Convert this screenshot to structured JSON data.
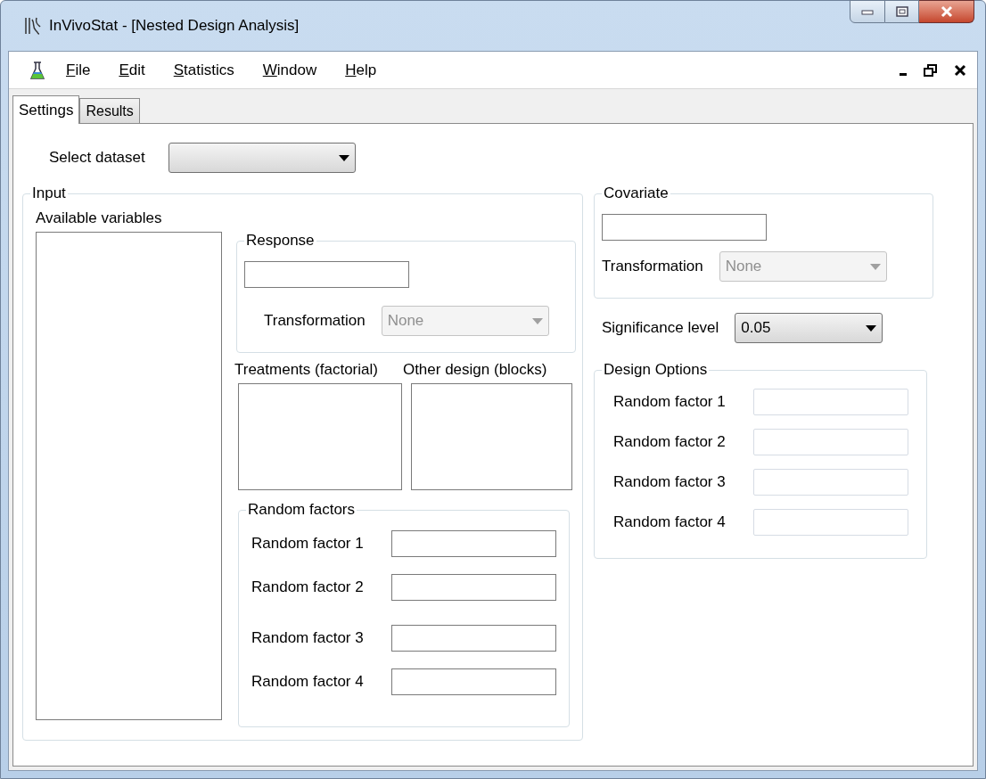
{
  "window": {
    "title": "InVivoStat - [Nested Design Analysis]"
  },
  "menu": [
    "File",
    "Edit",
    "Statistics",
    "Window",
    "Help"
  ],
  "tabs": [
    {
      "label": "Settings",
      "selected": true
    },
    {
      "label": "Results",
      "selected": false
    }
  ],
  "dataset": {
    "label": "Select dataset"
  },
  "input": {
    "title": "Input",
    "available_label": "Available variables",
    "response": {
      "title": "Response",
      "transformation_label": "Transformation",
      "transformation_value": "None",
      "disabled": true
    },
    "treatments_label": "Treatments (factorial)",
    "other_design_label": "Other design (blocks)",
    "random_factors": {
      "title": "Random factors",
      "items": [
        {
          "label": "Random factor 1",
          "disabled": false
        },
        {
          "label": "Random factor 2",
          "disabled": false
        },
        {
          "label": "Random factor 3",
          "disabled": false
        },
        {
          "label": "Random factor 4",
          "disabled": false
        }
      ]
    }
  },
  "covariate": {
    "title": "Covariate",
    "transformation_label": "Transformation",
    "transformation_value": "None",
    "disabled": true
  },
  "significance": {
    "label": "Significance level",
    "value": "0.05"
  },
  "design_options": {
    "title": "Design Options",
    "items": [
      {
        "label": "Random factor 1",
        "disabled": true
      },
      {
        "label": "Random factor 2",
        "disabled": true
      },
      {
        "label": "Random factor 3",
        "disabled": true
      },
      {
        "label": "Random factor 4",
        "disabled": true
      }
    ]
  }
}
